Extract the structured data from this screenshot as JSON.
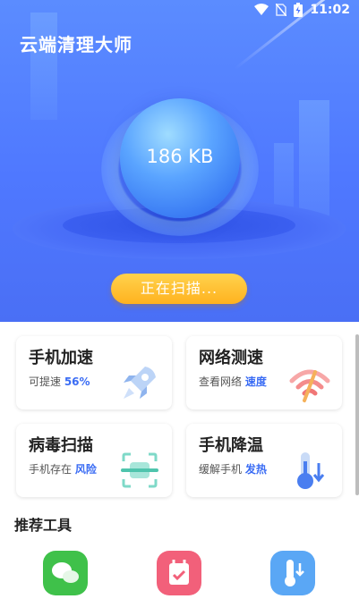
{
  "status_bar": {
    "time": "11:02"
  },
  "app": {
    "title": "云端清理大师"
  },
  "scan": {
    "size": "186 KB",
    "button_label": "正在扫描..."
  },
  "cards": [
    {
      "title": "手机加速",
      "sub_prefix": "可提速 ",
      "sub_highlight": "56%",
      "icon": "rocket-icon"
    },
    {
      "title": "网络测速",
      "sub_prefix": "查看网络 ",
      "sub_highlight": "速度",
      "icon": "wifi-icon"
    },
    {
      "title": "病毒扫描",
      "sub_prefix": "手机存在 ",
      "sub_highlight": "风险",
      "icon": "scan-icon"
    },
    {
      "title": "手机降温",
      "sub_prefix": "缓解手机 ",
      "sub_highlight": "发热",
      "icon": "thermometer-icon"
    }
  ],
  "recommended": {
    "title": "推荐工具",
    "tools": [
      {
        "icon": "wechat-icon",
        "color": "#3fc14a"
      },
      {
        "icon": "calendar-icon",
        "color": "#f2607a"
      },
      {
        "icon": "thermometer-icon",
        "color": "#5aa7f5"
      }
    ]
  },
  "colors": {
    "hero": "#5b8cff",
    "accent": "#3a6cf4",
    "button": "#ffc234"
  }
}
